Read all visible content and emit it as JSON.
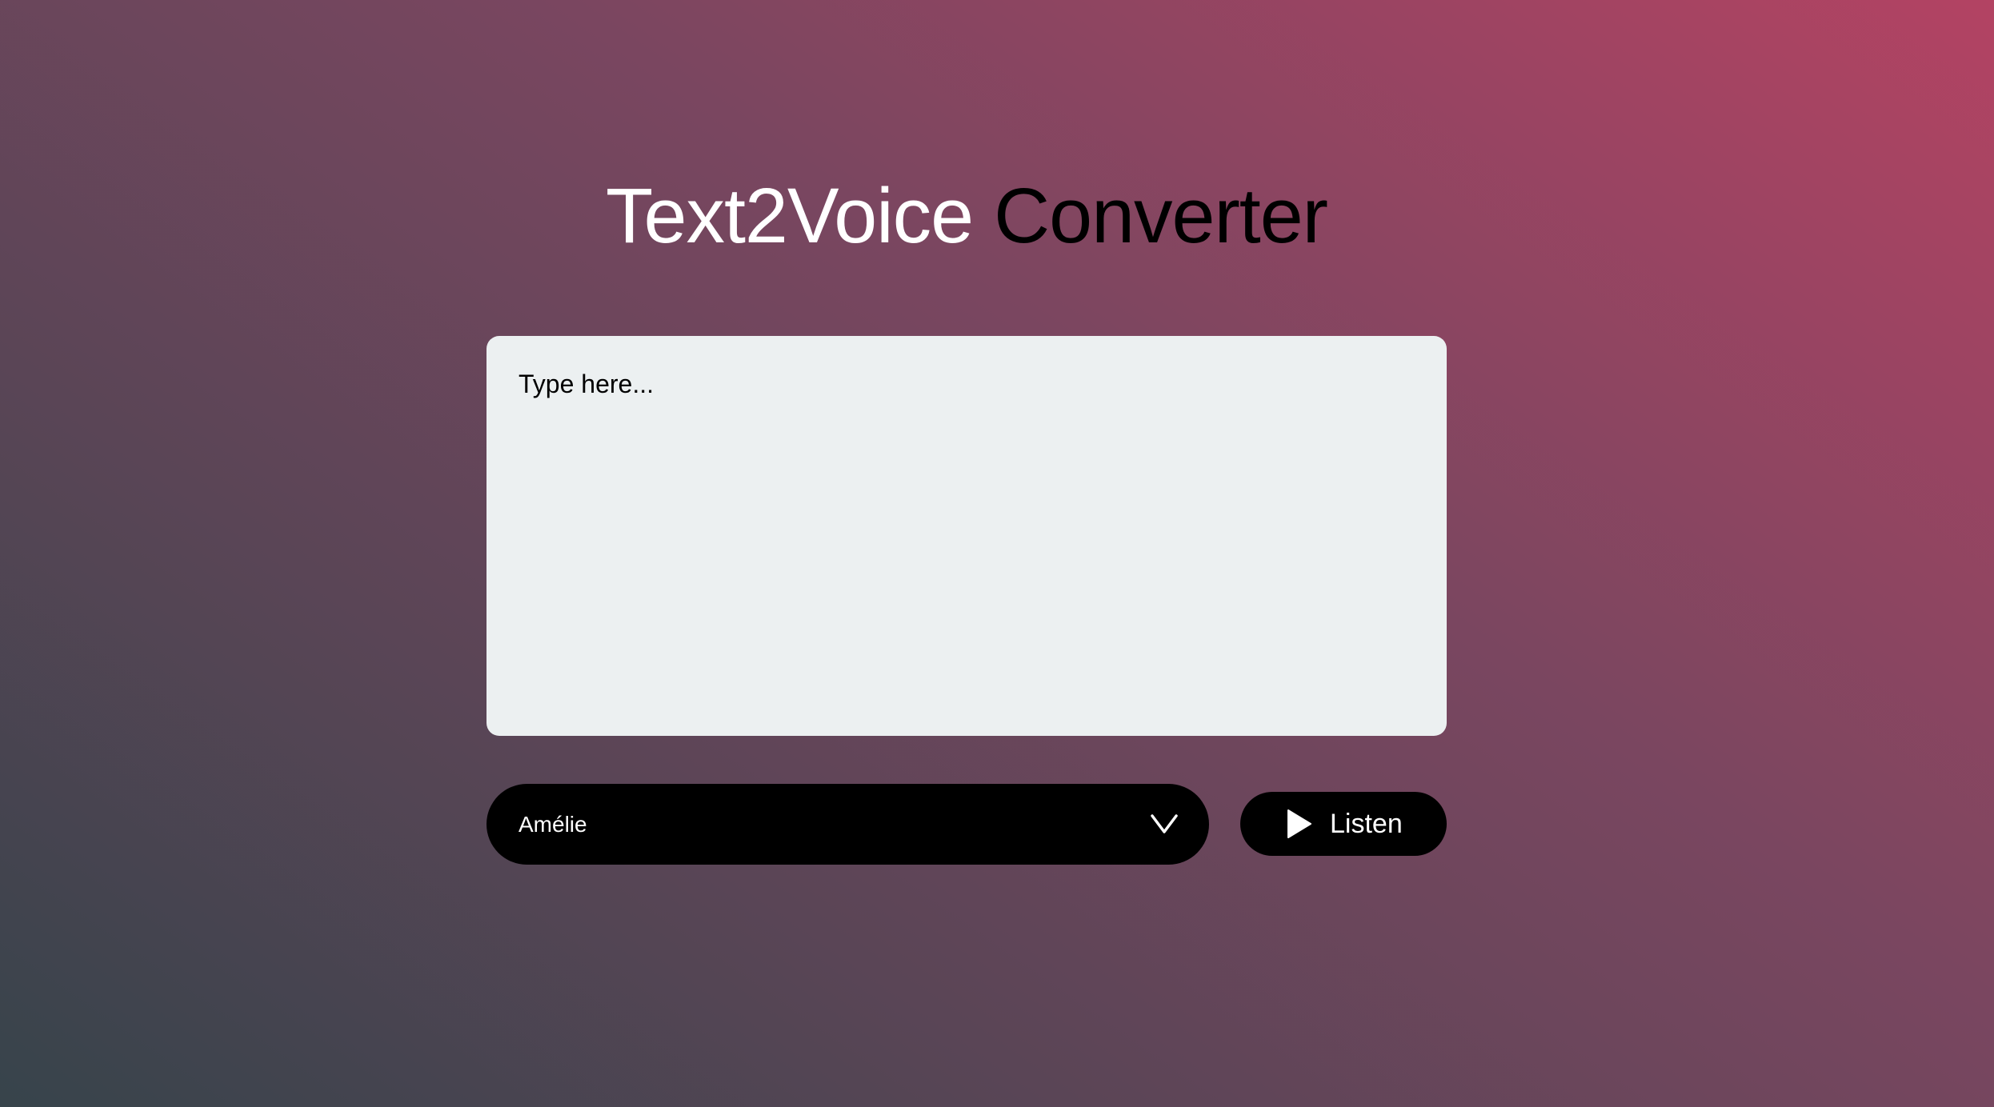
{
  "header": {
    "title_part1": "Text2Voice",
    "title_part2": "Converter"
  },
  "input": {
    "placeholder": "Type here...",
    "value": ""
  },
  "voice": {
    "selected": "Amélie",
    "icon": "chevron-down-icon"
  },
  "actions": {
    "listen_label": "Listen",
    "listen_icon": "play-icon"
  },
  "colors": {
    "title_primary": "#ffffff",
    "title_secondary": "#000000",
    "textarea_bg": "#ecf0f1",
    "controls_bg": "#000000"
  }
}
